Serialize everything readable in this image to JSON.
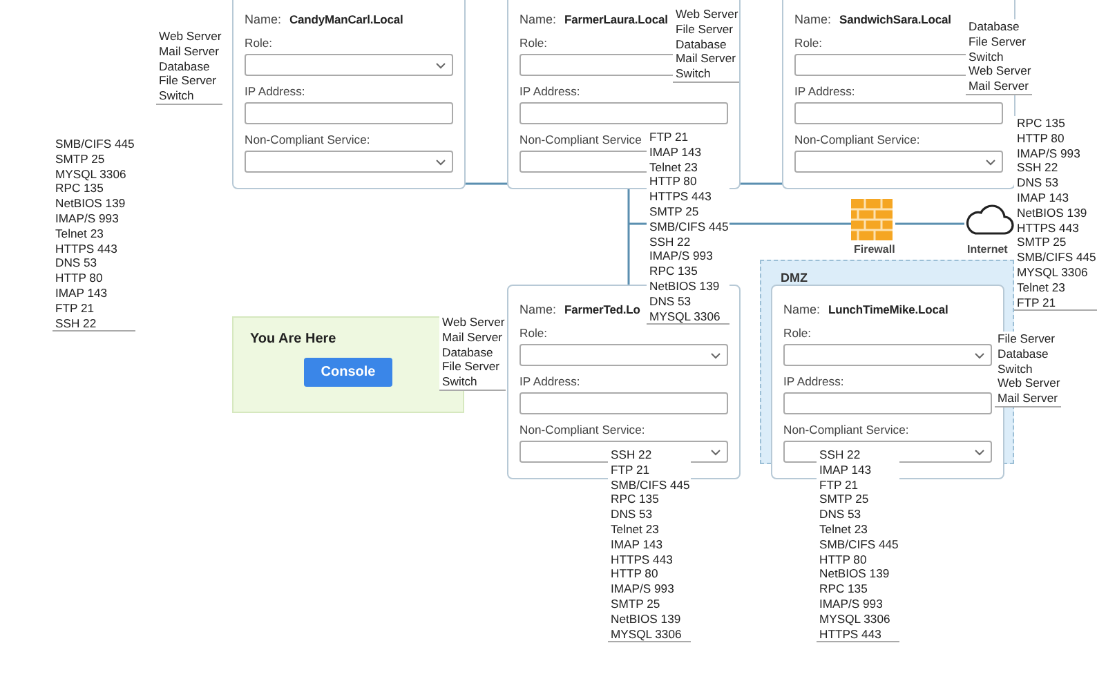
{
  "cards": [
    {
      "name_label": "Name:",
      "name": "CandyManCarl.Local",
      "fields": [
        {
          "label": "Role:",
          "kind": "select"
        },
        {
          "label": "IP Address:",
          "kind": "text"
        },
        {
          "label": "Non-Compliant Service:",
          "kind": "select"
        }
      ]
    },
    {
      "name_label": "Name:",
      "name": "FarmerLaura.Local",
      "fields": [
        {
          "label": "Role:",
          "kind": "select"
        },
        {
          "label": "IP Address:",
          "kind": "text"
        },
        {
          "label": "Non-Compliant Service",
          "kind": "select"
        }
      ]
    },
    {
      "name_label": "Name:",
      "name": "SandwichSara.Local",
      "fields": [
        {
          "label": "Role:",
          "kind": "select"
        },
        {
          "label": "IP Address:",
          "kind": "text"
        },
        {
          "label": "Non-Compliant Service:",
          "kind": "select"
        }
      ]
    },
    {
      "name_label": "Name:",
      "name": "FarmerTed.Lo",
      "fields": [
        {
          "label": "Role:",
          "kind": "select"
        },
        {
          "label": "IP Address:",
          "kind": "text"
        },
        {
          "label": "Non-Compliant Service:",
          "kind": "select"
        }
      ]
    },
    {
      "name_label": "Name:",
      "name": "LunchTimeMike.Local",
      "fields": [
        {
          "label": "Role:",
          "kind": "select"
        },
        {
          "label": "IP Address:",
          "kind": "text"
        },
        {
          "label": "Non-Compliant Service:",
          "kind": "select"
        }
      ]
    }
  ],
  "you_are_here": {
    "title": "You Are Here",
    "button": "Console"
  },
  "dmz": {
    "label": "DMZ"
  },
  "firewall": {
    "label": "Firewall"
  },
  "internet": {
    "label": "Internet"
  },
  "dropdown_lists": [
    {
      "items": [
        "Web Server",
        "Mail Server",
        "Database",
        "File Server",
        "Switch"
      ]
    },
    {
      "items": [
        "SMB/CIFS 445",
        "SMTP 25",
        "MYSQL 3306",
        "RPC 135",
        "NetBIOS 139",
        "IMAP/S 993",
        "Telnet 23",
        "HTTPS 443",
        "DNS 53",
        "HTTP 80",
        "IMAP 143",
        "FTP 21",
        "SSH 22"
      ]
    },
    {
      "items": [
        "Web Server",
        "File Server",
        "Database",
        "Mail Server",
        "Switch"
      ]
    },
    {
      "items": [
        "Database",
        "File Server",
        "Switch",
        "Web Server",
        "Mail Server"
      ]
    },
    {
      "items": [
        "FTP 21",
        "IMAP 143",
        "Telnet 23",
        "HTTP 80",
        "HTTPS 443",
        "SMTP 25",
        "SMB/CIFS 445",
        "SSH 22",
        "IMAP/S 993",
        "RPC 135",
        "NetBIOS 139",
        "DNS 53",
        "MYSQL 3306"
      ]
    },
    {
      "items": [
        "RPC 135",
        "HTTP 80",
        "IMAP/S 993",
        "SSH 22",
        "DNS 53",
        "IMAP 143",
        "NetBIOS 139",
        "HTTPS 443",
        "SMTP 25",
        "SMB/CIFS 445",
        "MYSQL 3306",
        "Telnet 23",
        "FTP 21"
      ]
    },
    {
      "items": [
        "Web Server",
        "Mail Server",
        "Database",
        "File Server",
        "Switch"
      ]
    },
    {
      "items": [
        "File Server",
        "Database",
        "Switch",
        "Web Server",
        "Mail Server"
      ]
    },
    {
      "items": [
        "SSH 22",
        "FTP 21",
        "SMB/CIFS 445",
        "RPC 135",
        "DNS 53",
        "Telnet 23",
        "IMAP 143",
        "HTTPS 443",
        "HTTP 80",
        "IMAP/S 993",
        "SMTP 25",
        "NetBIOS 139",
        "MYSQL 3306"
      ]
    },
    {
      "items": [
        "SSH 22",
        "IMAP 143",
        "FTP 21",
        "SMTP 25",
        "DNS 53",
        "Telnet 23",
        "SMB/CIFS 445",
        "HTTP 80",
        "NetBIOS 139",
        "RPC 135",
        "IMAP/S 993",
        "MYSQL 3306",
        "HTTPS 443"
      ]
    }
  ]
}
